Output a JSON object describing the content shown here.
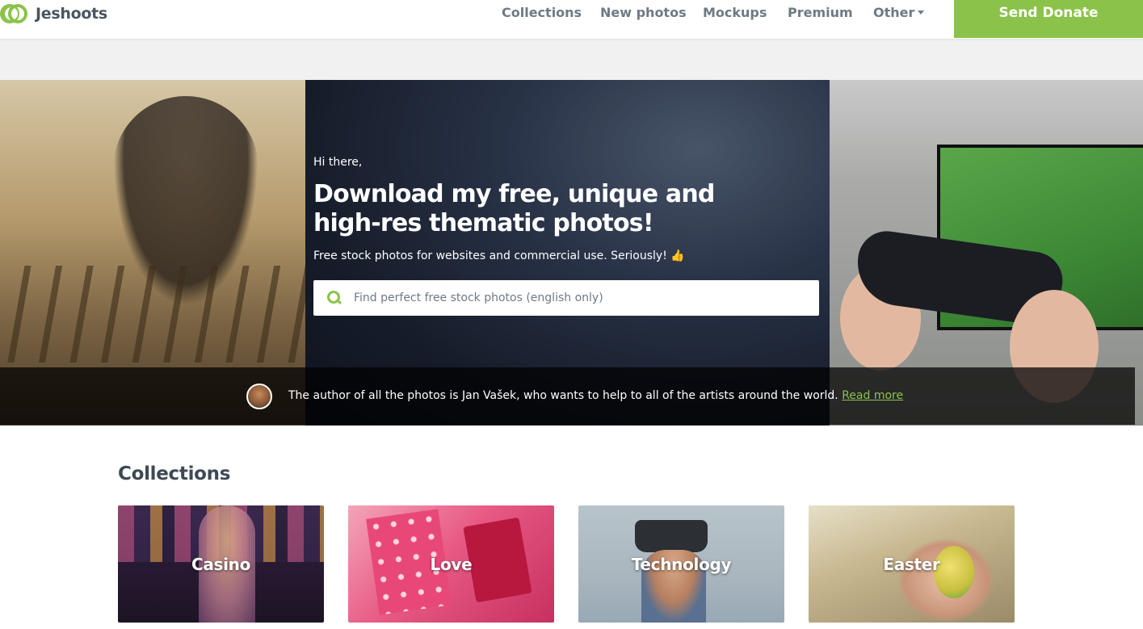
{
  "header": {
    "logo_text": "Jeshoots",
    "nav": [
      {
        "label": "Collections"
      },
      {
        "label": "New photos"
      },
      {
        "label": "Mockups"
      },
      {
        "label": "Premium"
      },
      {
        "label": "Other"
      }
    ],
    "donate_label": "Send Donate"
  },
  "hero": {
    "greeting": "Hi there,",
    "headline": "Download my free, unique and high-res thematic photos!",
    "tagline": "Free stock photos for websites and commercial use. Seriously! 👍",
    "search": {
      "placeholder": "Find perfect free stock photos (english only)",
      "value": ""
    },
    "author": {
      "text": "The author of all the photos is Jan Vašek, who wants to help to all of the artists around the world. ",
      "link": "Read more"
    }
  },
  "collections": {
    "title": "Collections",
    "items": [
      {
        "label": "Casino"
      },
      {
        "label": "Love"
      },
      {
        "label": "Technology"
      },
      {
        "label": "Easter"
      }
    ]
  },
  "colors": {
    "accent": "#8bc34a",
    "nav_text": "#6e7a84",
    "heading_text": "#3d4a54"
  },
  "icons": {
    "logo": "jeshoots-logo-icon",
    "search": "search-icon",
    "dropdown": "caret-down-icon"
  }
}
